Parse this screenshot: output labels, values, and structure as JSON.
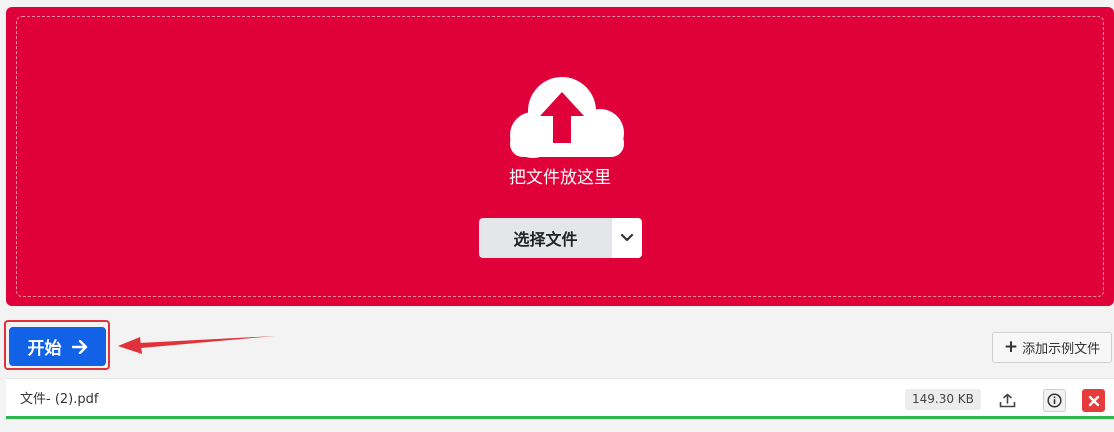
{
  "dropzone": {
    "drop_text": "把文件放这里",
    "choose_button": "选择文件",
    "icons": [
      "cloud-upload-icon",
      "chevron-down-icon"
    ],
    "color": "#e0013a"
  },
  "actions": {
    "start_button": "开始",
    "add_sample_button": "添加示例文件",
    "icons": [
      "arrow-right-icon",
      "plus-icon"
    ]
  },
  "file": {
    "name": "文件- (2).pdf",
    "size": "149.30 KB",
    "upload_progress": 1.0,
    "icons": [
      "save-icon",
      "info-icon",
      "close-icon"
    ]
  },
  "colors": {
    "accent": "#1262e8",
    "danger": "#e53b3b",
    "success": "#2db84d"
  }
}
